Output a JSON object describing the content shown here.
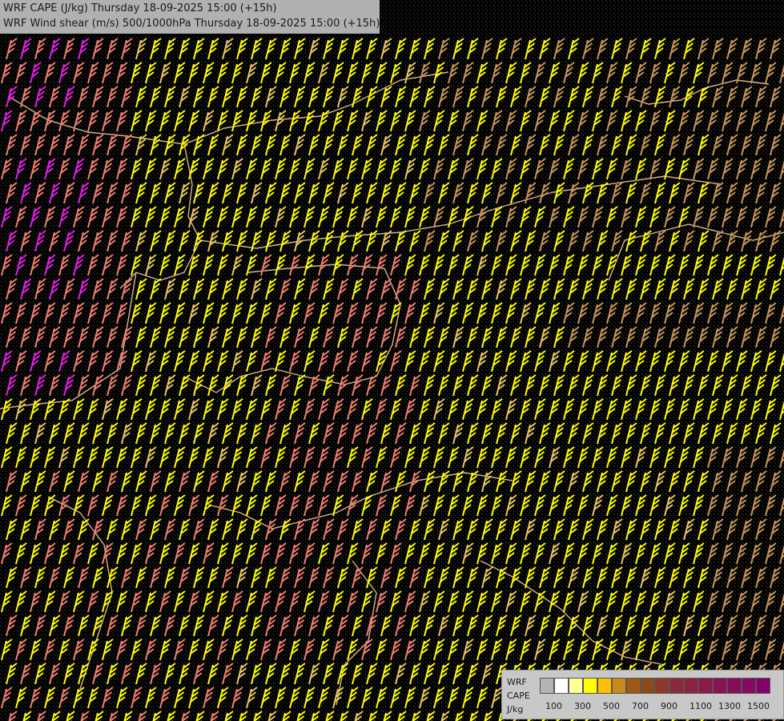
{
  "title": {
    "line1": "WRF CAPE (J/kg) Thursday 18-09-2025 15:00 (+15h)",
    "line2": "WRF Wind shear (m/s) 500/1000hPa Thursday 18-09-2025 15:00 (+15h)"
  },
  "legend": {
    "label_model": "WRF",
    "label_field": "CAPE",
    "label_unit": "J/kg",
    "colors": [
      "#b4b4b4",
      "#ffffff",
      "#ffff9a",
      "#ffff00",
      "#ffbf00",
      "#c88a1e",
      "#9c5a14",
      "#8a4a1a",
      "#8c3a2a",
      "#8a2a3a",
      "#8c2440",
      "#8a1c48",
      "#881452",
      "#860c5a",
      "#860a62",
      "#84006a"
    ],
    "ticks": [
      "100",
      "300",
      "500",
      "700",
      "900",
      "1100",
      "1300",
      "1500"
    ]
  }
}
